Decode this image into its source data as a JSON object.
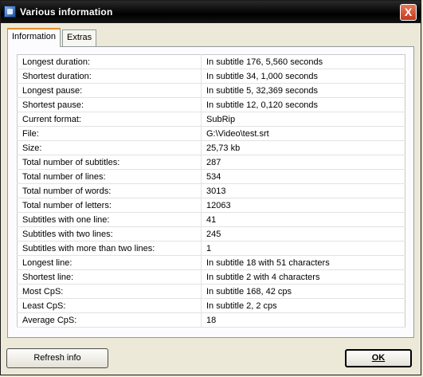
{
  "window": {
    "title": "Various information",
    "close_label": "X"
  },
  "tabs": [
    {
      "label": "Information"
    },
    {
      "label": "Extras"
    }
  ],
  "info_rows": [
    {
      "label": "Longest duration:",
      "value": "In subtitle 176, 5,560 seconds"
    },
    {
      "label": "Shortest duration:",
      "value": "In subtitle 34, 1,000 seconds"
    },
    {
      "label": "Longest pause:",
      "value": "In subtitle 5, 32,369 seconds"
    },
    {
      "label": "Shortest pause:",
      "value": "In subtitle 12, 0,120 seconds"
    },
    {
      "label": "Current format:",
      "value": "SubRip"
    },
    {
      "label": "File:",
      "value": "G:\\Video\\test.srt"
    },
    {
      "label": "Size:",
      "value": "25,73 kb"
    },
    {
      "label": "Total number of subtitles:",
      "value": "287"
    },
    {
      "label": "Total number of lines:",
      "value": "534"
    },
    {
      "label": "Total number of words:",
      "value": "3013"
    },
    {
      "label": "Total number of letters:",
      "value": "12063"
    },
    {
      "label": "Subtitles with one line:",
      "value": "41"
    },
    {
      "label": "Subtitles with two lines:",
      "value": "245"
    },
    {
      "label": "Subtitles with more than two lines:",
      "value": "1"
    },
    {
      "label": "Longest line:",
      "value": "In subtitle 18 with 51 characters"
    },
    {
      "label": "Shortest line:",
      "value": "In subtitle 2 with 4 characters"
    },
    {
      "label": "Most CpS:",
      "value": "In subtitle 168, 42 cps"
    },
    {
      "label": "Least CpS:",
      "value": "In subtitle 2, 2 cps"
    },
    {
      "label": "Average CpS:",
      "value": "18"
    }
  ],
  "buttons": {
    "refresh_label": "Refresh info",
    "ok_label": "OK"
  },
  "icons": {
    "app": "app-icon",
    "close": "close-icon"
  }
}
